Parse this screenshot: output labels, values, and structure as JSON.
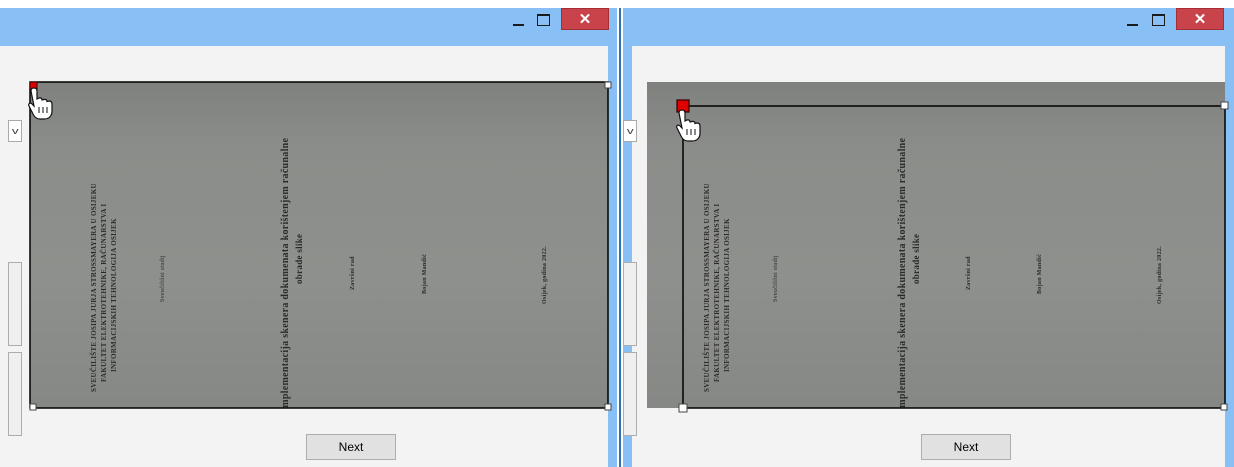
{
  "left_window": {
    "next_label": "Next",
    "document_lines": [
      "SVEUČILIŠTE JOSIPA JURJA STROSSMAYERA U OSIJEKU",
      "FAKULTET ELEKTROTEHNIKE, RAČUNARSTVA I",
      "INFORMACIJSKIH TEHNOLOGIJA OSIJEK",
      "Sveučilišni studij",
      "Implementacija skenera dokumenata korištenjem računalne",
      "obrade slike",
      "Završni rad",
      "Bojan Mandić",
      "Osijek, godina 2022."
    ]
  },
  "right_window": {
    "next_label": "Next",
    "document_lines": [
      "SVEUČILIŠTE JOSIPA JURJA STROSSMAYERA U OSIJEKU",
      "FAKULTET ELEKTROTEHNIKE, RAČUNARSTVA I",
      "INFORMACIJSKIH TEHNOLOGIJA OSIJEK",
      "Sveučilišni studij",
      "Implementacija skenera dokumenata korištenjem računalne",
      "obrade slike",
      "Završni rad",
      "Bojan Mandić",
      "Osijek, godina 2022."
    ]
  },
  "icons": {
    "minimize": "minimize-icon",
    "maximize": "maximize-icon",
    "close": "close-icon",
    "dropdown": "chevron-down-icon",
    "cursor": "hand-pointer-icon"
  },
  "colors": {
    "titlebar": "#88c0f5",
    "close": "#c9434a",
    "handle_active": "#e00000",
    "separator": "#2b6fb5"
  }
}
